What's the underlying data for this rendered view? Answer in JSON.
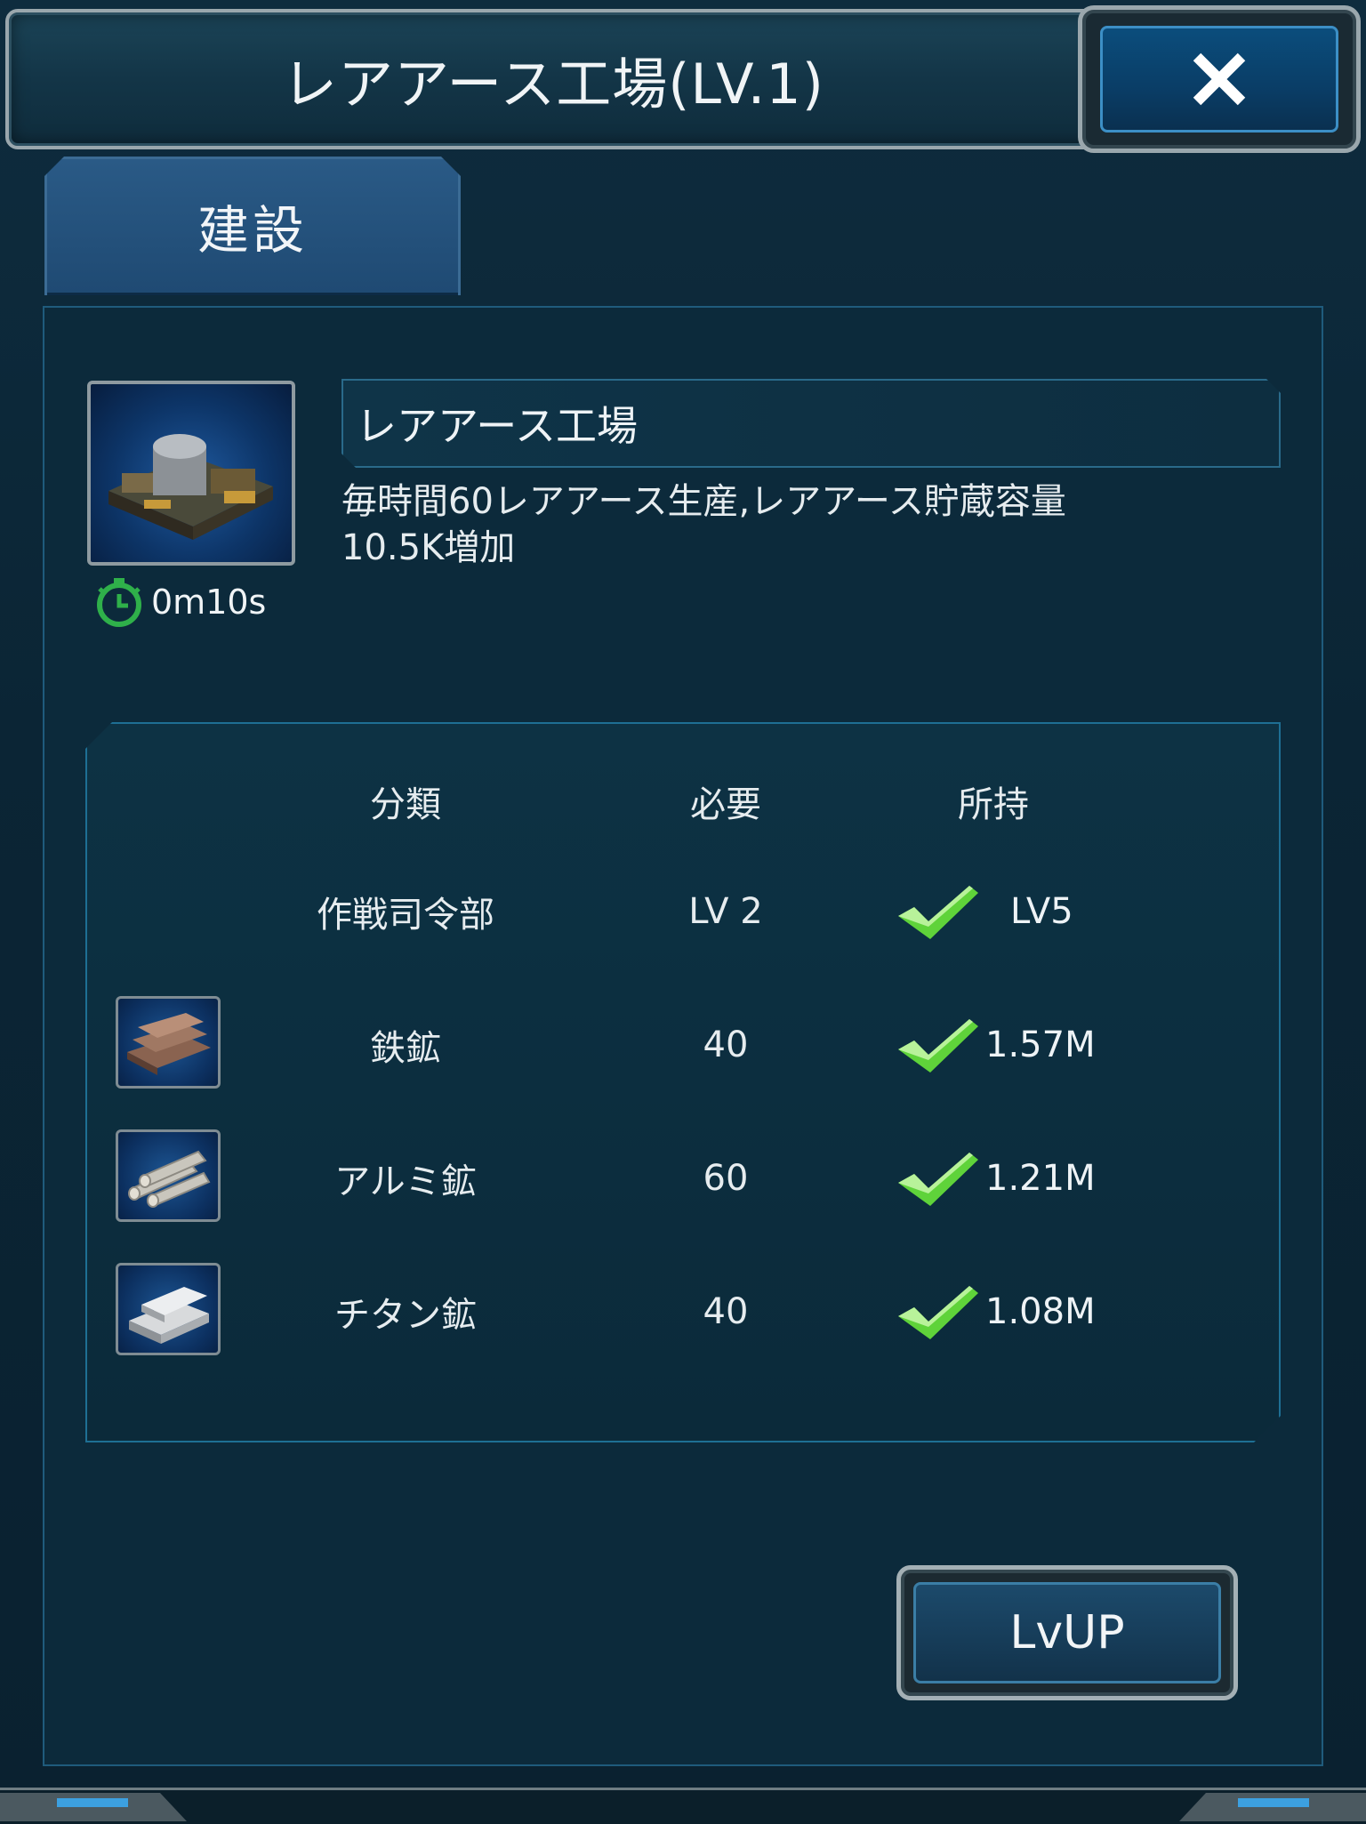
{
  "window": {
    "title": "レアアース工場(LV.1)",
    "close_icon": "close-icon"
  },
  "tabs": [
    {
      "label": "建設",
      "active": true
    }
  ],
  "building": {
    "name": "レアアース工場",
    "description_line1": "毎時間60レアアース生産,レアアース貯蔵容量",
    "description_line2": "10.5K増加",
    "build_time": "0m10s",
    "image": "factory-building-image"
  },
  "requirements": {
    "headers": {
      "category": "分類",
      "required": "必要",
      "owned": "所持"
    },
    "rows": [
      {
        "category": "作戦司令部",
        "required": "LV 2",
        "owned": "LV5",
        "met": true,
        "icon": null
      },
      {
        "category": "鉄鉱",
        "required": "40",
        "owned": "1.57M",
        "met": true,
        "icon": "iron-ore-icon"
      },
      {
        "category": "アルミ鉱",
        "required": "60",
        "owned": "1.21M",
        "met": true,
        "icon": "aluminum-ore-icon"
      },
      {
        "category": "チタン鉱",
        "required": "40",
        "owned": "1.08M",
        "met": true,
        "icon": "titanium-ore-icon"
      }
    ]
  },
  "actions": {
    "lvup_label": "LvUP"
  },
  "colors": {
    "background": "#0a2232",
    "accent_blue": "#3c8fc6",
    "check_green": "#5fd33a"
  }
}
